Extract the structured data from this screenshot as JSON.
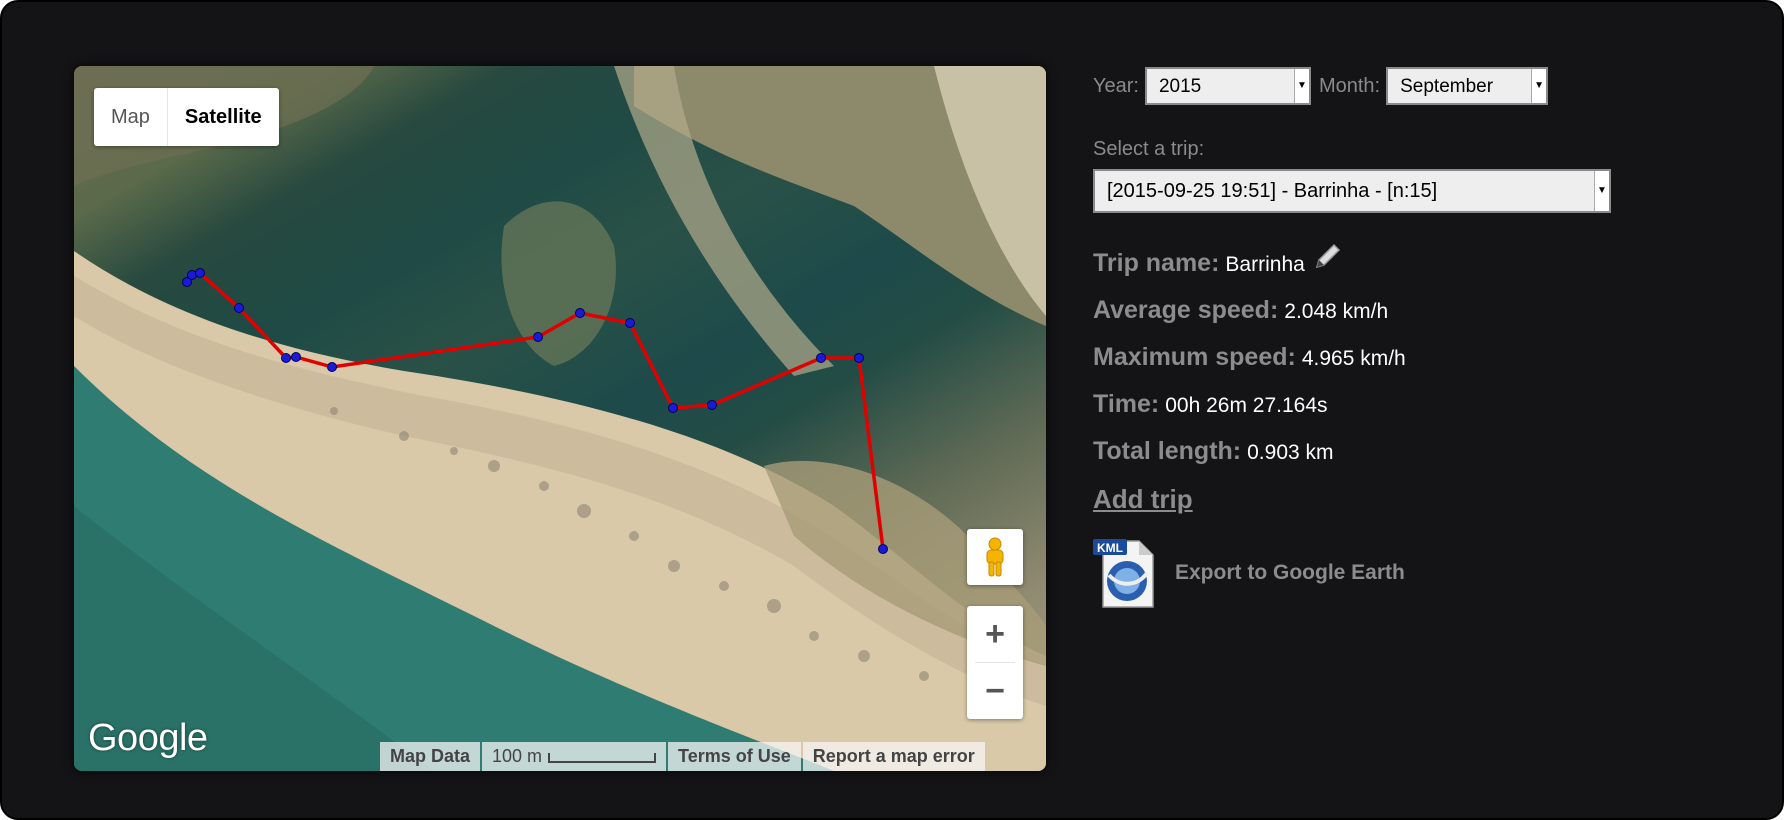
{
  "map": {
    "type_buttons": [
      "Map",
      "Satellite"
    ],
    "active_type": "Satellite",
    "logo": "Google",
    "attribution": {
      "map_data": "Map Data",
      "scale_label": "100 m",
      "terms": "Terms of Use",
      "report": "Report a map error"
    },
    "zoom_in": "+",
    "zoom_out": "−",
    "route_color": "#e00000",
    "point_color": "#1a1ad8",
    "icons": [
      "pegman-icon",
      "zoom-in-icon",
      "zoom-out-icon"
    ]
  },
  "filters": {
    "year_label": "Year:",
    "year_value": "2015",
    "month_label": "Month:",
    "month_value": "September"
  },
  "trip_select": {
    "label": "Select a trip:",
    "value": "[2015-09-25 19:51] - Barrinha - [n:15]"
  },
  "stats": {
    "trip_name_label": "Trip name:",
    "trip_name_value": "Barrinha",
    "avg_speed_label": "Average speed:",
    "avg_speed_value": "2.048 km/h",
    "max_speed_label": "Maximum speed:",
    "max_speed_value": "4.965 km/h",
    "time_label": "Time:",
    "time_value": "00h 26m 27.164s",
    "length_label": "Total length:",
    "length_value": "0.903 km"
  },
  "actions": {
    "add_trip": "Add trip",
    "kml_badge": "KML",
    "export_label": "Export to Google Earth"
  }
}
